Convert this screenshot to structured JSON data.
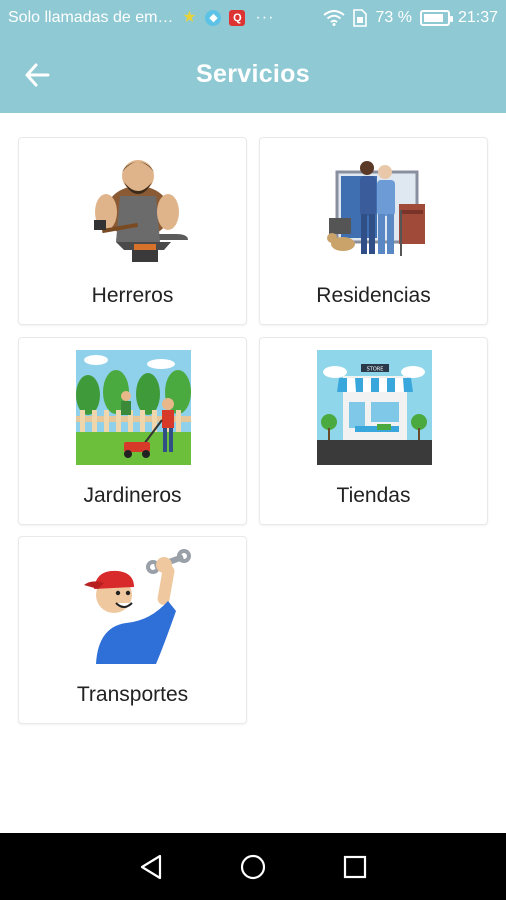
{
  "status_bar": {
    "carrier": "Solo llamadas de em…",
    "dots": "···",
    "battery_percent": "73 %",
    "battery_level": 0.73,
    "time": "21:37"
  },
  "app_bar": {
    "title": "Servicios",
    "back_icon": "arrow-left-icon"
  },
  "services": [
    {
      "label": "Herreros",
      "icon": "blacksmith-illustration"
    },
    {
      "label": "Residencias",
      "icon": "nursing-home-illustration"
    },
    {
      "label": "Jardineros",
      "icon": "gardener-illustration"
    },
    {
      "label": "Tiendas",
      "icon": "store-illustration"
    },
    {
      "label": "Transportes",
      "icon": "mechanic-illustration"
    }
  ],
  "nav_bar": {
    "back_icon": "triangle-back-icon",
    "home_icon": "circle-home-icon",
    "recents_icon": "square-recents-icon"
  },
  "colors": {
    "primary": "#8fc9d3",
    "background": "#ffffff",
    "text": "#222222",
    "nav_bar": "#000000"
  }
}
